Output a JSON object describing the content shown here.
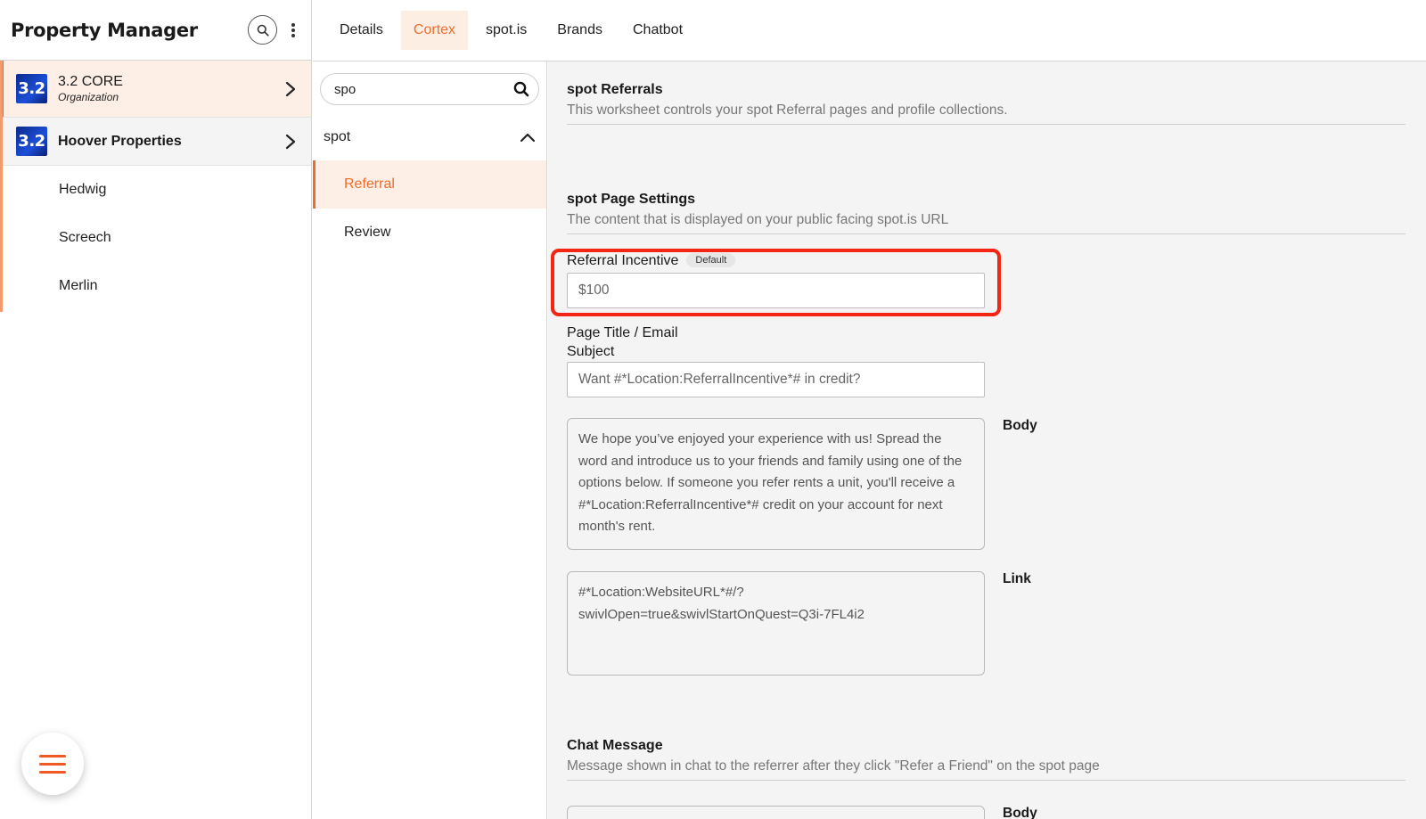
{
  "sidebar": {
    "title": "Property Manager",
    "icons": {
      "search": "search-icon",
      "more": "kebab-menu-icon",
      "menu": "hamburger-icon"
    },
    "orgs": [
      {
        "badge": "3.2",
        "name": "3.2 CORE",
        "sub": "Organization"
      },
      {
        "badge": "3.2",
        "name": "Hoover Properties"
      }
    ],
    "properties": [
      "Hedwig",
      "Screech",
      "Merlin"
    ]
  },
  "tabs": [
    "Details",
    "Cortex",
    "spot.is",
    "Brands",
    "Chatbot"
  ],
  "active_tab": "Cortex",
  "middle": {
    "search_value": "spo",
    "group": "spot",
    "items": [
      "Referral",
      "Review"
    ],
    "active_item": "Referral"
  },
  "main": {
    "referrals": {
      "title": "spot Referrals",
      "desc": "This worksheet controls your spot Referral pages and profile collections."
    },
    "page_settings": {
      "title": "spot Page Settings",
      "desc": "The content that is displayed on your public facing spot.is URL"
    },
    "incentive": {
      "label": "Referral Incentive",
      "pill": "Default",
      "placeholder": "$100"
    },
    "page_title": {
      "label_line1": "Page Title / Email",
      "label_line2": "Subject",
      "placeholder": "Want #*Location:ReferralIncentive*# in credit?"
    },
    "body": {
      "label": "Body",
      "text": "We hope you’ve enjoyed your experience with us! Spread the word and introduce us to your friends and family using one of the options below. If someone you refer rents a unit, you'll receive a #*Location:ReferralIncentive*# credit on your account for next month's rent."
    },
    "link": {
      "label": "Link",
      "text_line1": "#*Location:WebsiteURL*#/?",
      "text_line2": "swivlOpen=true&swivlStartOnQuest=Q3i-7FL4i2"
    },
    "chat": {
      "title": "Chat Message",
      "desc": "Message shown in chat to the referrer after they click \"Refer a Friend\" on the spot page",
      "body_label": "Body"
    }
  },
  "colors": {
    "accent": "#ef6c2b",
    "highlight": "#f22612",
    "badge": "#1c4fd9"
  }
}
